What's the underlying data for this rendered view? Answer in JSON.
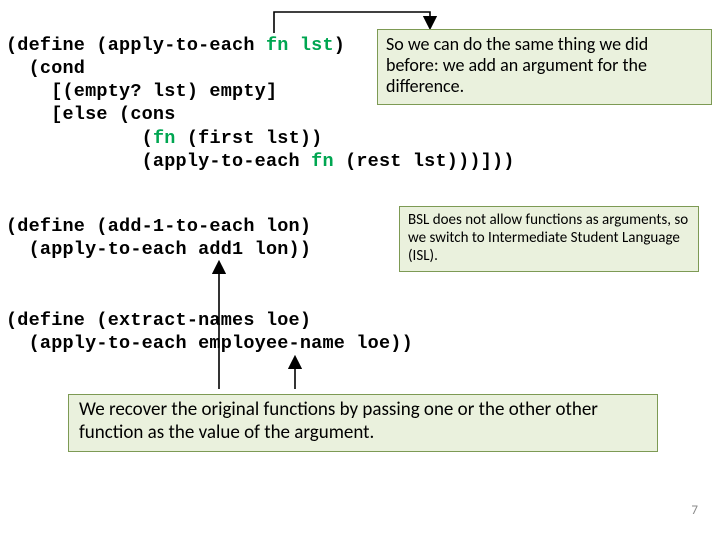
{
  "code": {
    "def_apply_open": "(define (apply-to-each ",
    "fn1": "fn",
    "sp1": " ",
    "lst1": "lst",
    "def_apply_close": ")",
    "cond_open": "  (cond",
    "empty_clause": "    [(empty? lst) empty]",
    "else_open": "    [else (cons",
    "fn_call_a": "            (",
    "fn2": "fn",
    "fn_call_b": " (first lst))",
    "recur_a": "            (apply-to-each ",
    "fn3": "fn",
    "recur_b": " (rest lst)))]))",
    "add1_a": "(define (add-1-to-each lon)",
    "add1_b": "  (apply-to-each add1 lon))",
    "extract_a": "(define (extract-names loe)",
    "extract_b": "  (apply-to-each employee-name loe))"
  },
  "callouts": {
    "c1": "So we can do the same thing we did before:  we add an argument for the difference.",
    "c2": "BSL does not allow functions as arguments, so we switch to Intermediate Student Language (ISL).",
    "c3": "We recover the original functions by passing one or the other other function as the value of the argument."
  },
  "pagenum": "7"
}
